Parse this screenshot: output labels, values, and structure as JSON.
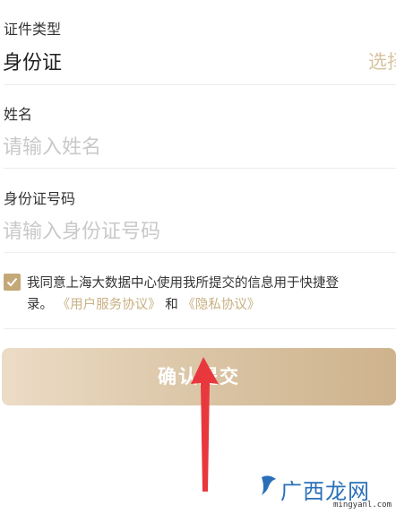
{
  "doc_type": {
    "label": "证件类型",
    "value": "身份证",
    "select_label": "选择"
  },
  "name": {
    "label": "姓名",
    "placeholder": "请输入姓名"
  },
  "id_number": {
    "label": "身份证号码",
    "placeholder": "请输入身份证号码"
  },
  "agreement": {
    "text_line1": "我同意上海大数据中心使用我所提交的信息用于快捷登",
    "text_line2_start": "录。",
    "user_service_link": "《用户服务协议》",
    "and_text": "和",
    "privacy_link": "《隐私协议》",
    "checked": true
  },
  "submit": {
    "label": "确认提交"
  },
  "watermark": {
    "brand": "广西龙网",
    "domain": "mingyanl.com"
  },
  "colors": {
    "accent": "#c4a878",
    "link": "#c9b083",
    "arrow": "#e8383d",
    "watermark": "#2a6fb8"
  }
}
